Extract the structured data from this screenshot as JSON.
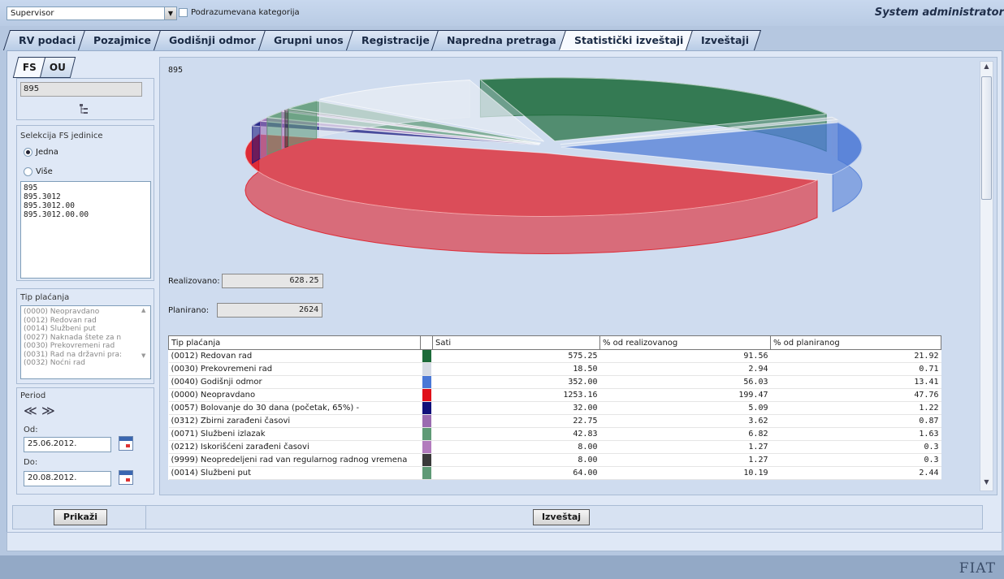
{
  "header": {
    "role_select": "Supervisor",
    "default_category_label": "Podrazumevana kategorija",
    "user_title": "System administrator"
  },
  "tabs": [
    {
      "label": "RV podaci",
      "active": false
    },
    {
      "label": "Pozajmice",
      "active": false
    },
    {
      "label": "Godišnji odmor",
      "active": false
    },
    {
      "label": "Grupni unos",
      "active": false
    },
    {
      "label": "Registracije",
      "active": false
    },
    {
      "label": "Napredna pretraga",
      "active": false
    },
    {
      "label": "Statistički izveštaji",
      "active": true
    },
    {
      "label": "Izveštaji",
      "active": false
    }
  ],
  "left": {
    "subtabs": [
      {
        "label": "FS",
        "active": true
      },
      {
        "label": "OU",
        "active": false
      }
    ],
    "unit_field": "895",
    "tree_icon": "org-tree-icon",
    "selection_title": "Selekcija FS jedinice",
    "radio_one": "Jedna",
    "radio_many": "Više",
    "units": [
      "895",
      "895.3012",
      "895.3012.00",
      "895.3012.00.00"
    ],
    "payment_title": "Tip plaćanja",
    "payment_types": [
      "(0000) Neopravdano",
      "(0012) Redovan rad",
      "(0014) Službeni put",
      "(0027) Naknada štete za n",
      "(0030) Prekovremeni rad",
      "(0031) Rad na državni pra:",
      "(0032) Noćni rad"
    ],
    "period_title": "Period",
    "prev_symbol": "≪",
    "next_symbol": "≫",
    "from_label": "Od:",
    "from_value": "25.06.2012.",
    "to_label": "Do:",
    "to_value": "20.08.2012."
  },
  "content": {
    "title": "895",
    "realized_label": "Realizovano:",
    "realized_value": "628.25",
    "planned_label": "Planirano:",
    "planned_value": "2624",
    "columns": [
      "Tip plaćanja",
      "",
      "Sati",
      "% od realizovanog",
      "% od planiranog"
    ],
    "rows": [
      {
        "type": "(0012) Redovan rad",
        "color": "#1d6b3a",
        "hours": "575.25",
        "pct_real": "91.56",
        "pct_plan": "21.92"
      },
      {
        "type": "(0030) Prekovremeni rad",
        "color": "#d6dbe4",
        "hours": "18.50",
        "pct_real": "2.94",
        "pct_plan": "0.71"
      },
      {
        "type": "(0040) Godišnji odmor",
        "color": "#4a78d6",
        "hours": "352.00",
        "pct_real": "56.03",
        "pct_plan": "13.41"
      },
      {
        "type": "(0000) Neopravdano",
        "color": "#e0101a",
        "hours": "1253.16",
        "pct_real": "199.47",
        "pct_plan": "47.76"
      },
      {
        "type": "(0057) Bolovanje do 30 dana (početak, 65%) -",
        "color": "#10107a",
        "hours": "32.00",
        "pct_real": "5.09",
        "pct_plan": "1.22"
      },
      {
        "type": "(0312) Zbirni zarađeni časovi",
        "color": "#9a6bb0",
        "hours": "22.75",
        "pct_real": "3.62",
        "pct_plan": "0.87"
      },
      {
        "type": "(0071) Službeni izlazak",
        "color": "#5f9a76",
        "hours": "42.83",
        "pct_real": "6.82",
        "pct_plan": "1.63"
      },
      {
        "type": "(0212) Iskorišćeni zarađeni časovi",
        "color": "#b27bbd",
        "hours": "8.00",
        "pct_real": "1.27",
        "pct_plan": "0.3"
      },
      {
        "type": "(9999) Neopredeljeni rad van regularnog radnog vremena",
        "color": "#3a3a3a",
        "hours": "8.00",
        "pct_real": "1.27",
        "pct_plan": "0.3"
      },
      {
        "type": "(0014) Službeni put",
        "color": "#5f9a76",
        "hours": "64.00",
        "pct_real": "10.19",
        "pct_plan": "2.44"
      }
    ],
    "chart_data": {
      "type": "pie",
      "title": "",
      "categories": [
        "(0012) Redovan rad",
        "(0030) Prekovremeni rad",
        "(0040) Godišnji odmor",
        "(0000) Neopravdano",
        "(0057) Bolovanje do 30 dana (početak, 65%) -",
        "(0312) Zbirni zarađeni časovi",
        "(0071) Službeni izlazak",
        "(0212) Iskorišćeni zarađeni časovi",
        "(9999) Neopredeljeni rad van regularnog radnog vremena",
        "(0014) Službeni put"
      ],
      "values": [
        575.25,
        18.5,
        352.0,
        1253.16,
        32.0,
        22.75,
        42.83,
        8.0,
        8.0,
        64.0
      ],
      "remaining_segment_color": "#e6ebf3",
      "style": "3d-exploded"
    }
  },
  "buttons": {
    "show": "Prikaži",
    "report": "Izveštaj"
  },
  "footer": {
    "logo": "FIAT"
  }
}
